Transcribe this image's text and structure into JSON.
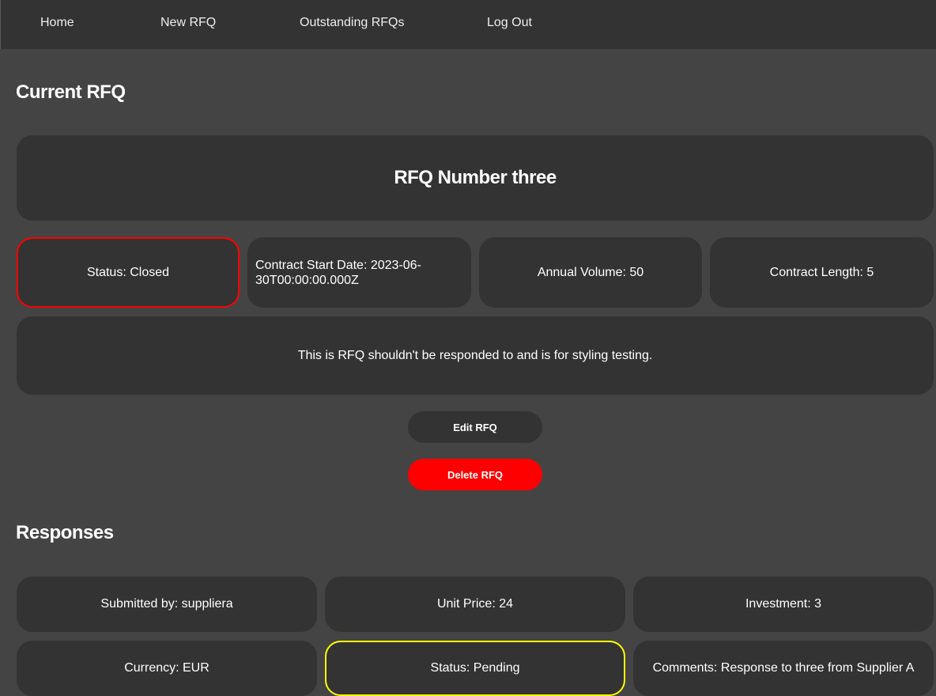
{
  "nav": {
    "items": [
      "Home",
      "New RFQ",
      "Outstanding RFQs",
      "Log Out"
    ]
  },
  "current_heading": "Current RFQ",
  "rfq": {
    "title": "RFQ Number three",
    "status": "Status: Closed",
    "contract_start": "Contract Start Date: 2023-06-30T00:00:00.000Z",
    "annual_volume": "Annual Volume: 50",
    "contract_length": "Contract Length: 5",
    "description": "This is RFQ shouldn't be responded to and is for styling testing."
  },
  "actions": {
    "edit_label": "Edit RFQ",
    "delete_label": "Delete RFQ"
  },
  "responses_heading": "Responses",
  "response": {
    "submitted_by": "Submitted by: suppliera",
    "unit_price": "Unit Price: 24",
    "investment": "Investment: 3",
    "currency": "Currency: EUR",
    "status": "Status: Pending",
    "comments": "Comments: Response to three from Supplier A"
  },
  "colors": {
    "background": "#444444",
    "card": "#333333",
    "closed_border": "#ff0000",
    "pending_border": "#ffff00",
    "delete_button": "#ff0000"
  }
}
